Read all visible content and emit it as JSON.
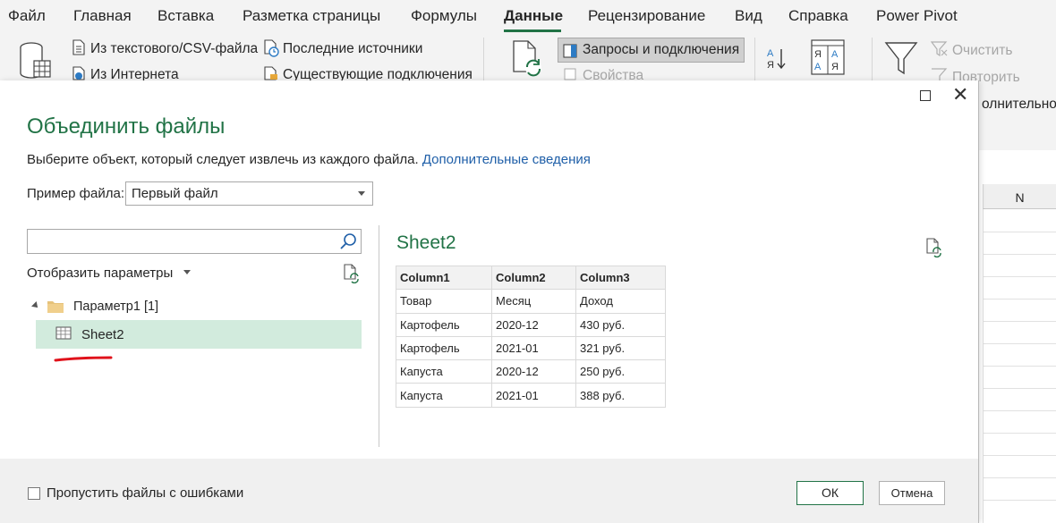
{
  "ribbon": {
    "tabs": [
      "Файл",
      "Главная",
      "Вставка",
      "Разметка страницы",
      "Формулы",
      "Данные",
      "Рецензирование",
      "Вид",
      "Справка",
      "Power Pivot"
    ],
    "active_tab": "Данные",
    "from_text_csv": "Из текстового/CSV-файла",
    "from_web": "Из Интернета",
    "recent_sources": "Последние источники",
    "existing_connections": "Существующие подключения",
    "queries_connections": "Запросы и подключения",
    "properties": "Свойства",
    "clear": "Очистить",
    "reapply": "Повторить",
    "advanced_partial": "олнительно"
  },
  "sheet": {
    "column_letter": "N"
  },
  "dialog": {
    "title": "Объединить файлы",
    "subtitle": "Выберите объект, который следует извлечь из каждого файла.",
    "more_info_link": "Дополнительные сведения",
    "sample_file_label": "Пример файла:",
    "sample_file_value": "Первый файл",
    "search_placeholder": "",
    "display_options": "Отобразить параметры",
    "tree": {
      "parameter_label": "Параметр1 [1]",
      "selected_item": "Sheet2"
    },
    "preview": {
      "title": "Sheet2",
      "columns": [
        "Column1",
        "Column2",
        "Column3"
      ],
      "rows": [
        [
          "Товар",
          "Месяц",
          "Доход"
        ],
        [
          "Картофель",
          "2020-12",
          "430 руб."
        ],
        [
          "Картофель",
          "2021-01",
          "321 руб."
        ],
        [
          "Капуста",
          "2020-12",
          "250 руб."
        ],
        [
          "Капуста",
          "2021-01",
          "388 руб."
        ]
      ]
    },
    "skip_errors_label": "Пропустить файлы с ошибками",
    "skip_errors_checked": false,
    "ok_label": "ОК",
    "cancel_label": "Отмена"
  },
  "colors": {
    "accent_green": "#217346",
    "link_blue": "#1f5fa8",
    "selected_row": "#d2ebdd",
    "annotation_red": "#e0121b"
  }
}
